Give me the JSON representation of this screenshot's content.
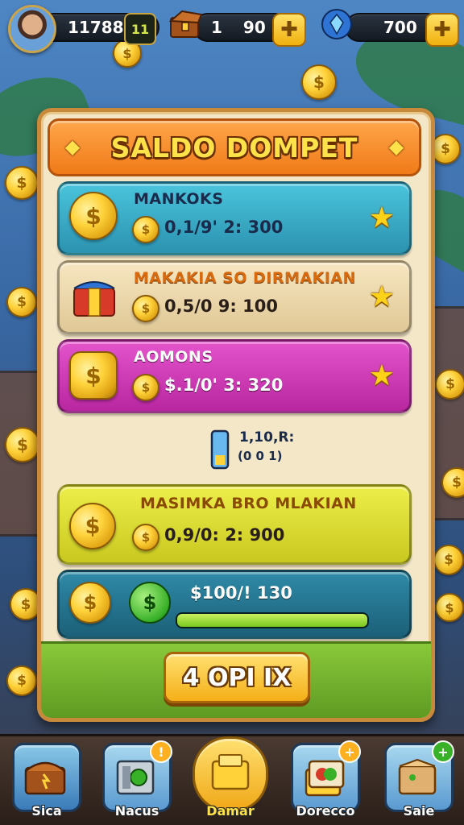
{
  "hud": {
    "player_score": "11788",
    "level_badge": "11",
    "chest_count": "1",
    "chest_value": "90",
    "gem_value": "700"
  },
  "panel": {
    "title": "SALDO DOMPET"
  },
  "rows": [
    {
      "title": "MANKOKS",
      "value": "0,1/9' 2: 300",
      "color": "#3ab0c8",
      "title_color": "#1a2a4a"
    },
    {
      "title": "MAKAKIA SO DIRMAKIAN",
      "value": "0,5/0 9: 100",
      "color": "#f0dcb0",
      "title_color": "#d86a10"
    },
    {
      "title": "AOMONS",
      "value": "$.1/0' 3: 320",
      "color": "#d43ab8",
      "title_color": "#ffffff"
    },
    {
      "title": "MASIMKA BRO MLAKIAN",
      "value": "0,9/0: 2: 900",
      "color": "#e4e43a",
      "title_color": "#8a4a00"
    }
  ],
  "middle_item": {
    "label": "1,10,R:",
    "sublabel": "(0 0 1)"
  },
  "last_row": {
    "value": "$100/! 130",
    "progress": 1.0
  },
  "claim_button": {
    "label": "4 OPI IX"
  },
  "nav": [
    {
      "label": "Sica",
      "badge": ""
    },
    {
      "label": "Nacus",
      "badge": "!"
    },
    {
      "label": "Damar",
      "badge": ""
    },
    {
      "label": "Dorecco",
      "badge": "+"
    },
    {
      "label": "Saie",
      "badge": "+"
    }
  ],
  "colors": {
    "accent": "#f07a18",
    "gold": "#ffd23a",
    "panel": "#f4e7c8"
  }
}
